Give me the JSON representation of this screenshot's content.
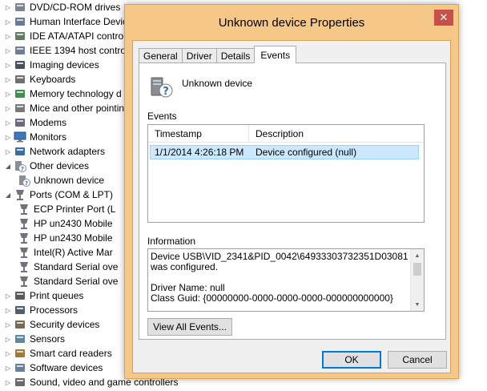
{
  "tree": {
    "items": [
      {
        "label": "DVD/CD-ROM drives",
        "icon": "dvd-drive-icon",
        "level": 0,
        "expander": "collapsed"
      },
      {
        "label": "Human Interface Devic",
        "icon": "hid-icon",
        "level": 0,
        "expander": "collapsed"
      },
      {
        "label": "IDE ATA/ATAPI control",
        "icon": "ide-controller-icon",
        "level": 0,
        "expander": "collapsed"
      },
      {
        "label": "IEEE 1394 host controll",
        "icon": "ieee1394-icon",
        "level": 0,
        "expander": "collapsed"
      },
      {
        "label": "Imaging devices",
        "icon": "camera-icon",
        "level": 0,
        "expander": "collapsed"
      },
      {
        "label": "Keyboards",
        "icon": "keyboard-icon",
        "level": 0,
        "expander": "collapsed"
      },
      {
        "label": "Memory technology d",
        "icon": "memory-icon",
        "level": 0,
        "expander": "collapsed"
      },
      {
        "label": "Mice and other pointin",
        "icon": "mouse-icon",
        "level": 0,
        "expander": "collapsed"
      },
      {
        "label": "Modems",
        "icon": "modem-icon",
        "level": 0,
        "expander": "collapsed"
      },
      {
        "label": "Monitors",
        "icon": "monitor-icon",
        "level": 0,
        "expander": "collapsed"
      },
      {
        "label": "Network adapters",
        "icon": "network-adapter-icon",
        "level": 0,
        "expander": "collapsed"
      },
      {
        "label": "Other devices",
        "icon": "other-devices-icon",
        "level": 0,
        "expander": "expanded"
      },
      {
        "label": "Unknown device",
        "icon": "unknown-device-icon",
        "level": 1,
        "expander": "none"
      },
      {
        "label": "Ports (COM & LPT)",
        "icon": "port-icon",
        "level": 0,
        "expander": "expanded"
      },
      {
        "label": "ECP Printer Port (L",
        "icon": "port-icon",
        "level": 1,
        "expander": "none"
      },
      {
        "label": "HP un2430 Mobile",
        "icon": "port-icon",
        "level": 1,
        "expander": "none"
      },
      {
        "label": "HP un2430 Mobile",
        "icon": "port-icon",
        "level": 1,
        "expander": "none"
      },
      {
        "label": "Intel(R) Active Mar",
        "icon": "port-icon",
        "level": 1,
        "expander": "none"
      },
      {
        "label": "Standard Serial ove",
        "icon": "port-icon",
        "level": 1,
        "expander": "none"
      },
      {
        "label": "Standard Serial ove",
        "icon": "port-icon",
        "level": 1,
        "expander": "none"
      },
      {
        "label": "Print queues",
        "icon": "printer-icon",
        "level": 0,
        "expander": "collapsed"
      },
      {
        "label": "Processors",
        "icon": "processor-icon",
        "level": 0,
        "expander": "collapsed"
      },
      {
        "label": "Security devices",
        "icon": "security-device-icon",
        "level": 0,
        "expander": "collapsed"
      },
      {
        "label": "Sensors",
        "icon": "sensor-icon",
        "level": 0,
        "expander": "collapsed"
      },
      {
        "label": "Smart card readers",
        "icon": "smart-card-icon",
        "level": 0,
        "expander": "collapsed"
      },
      {
        "label": "Software devices",
        "icon": "software-device-icon",
        "level": 0,
        "expander": "collapsed"
      },
      {
        "label": "Sound, video and game controllers",
        "icon": "sound-icon",
        "level": 0,
        "expander": "collapsed"
      }
    ]
  },
  "dialog": {
    "title": "Unknown device Properties",
    "close_glyph": "✕",
    "tabs": [
      {
        "label": "General",
        "active": false
      },
      {
        "label": "Driver",
        "active": false
      },
      {
        "label": "Details",
        "active": false
      },
      {
        "label": "Events",
        "active": true
      }
    ],
    "device_name": "Unknown device",
    "events_label": "Events",
    "events_columns": {
      "timestamp": "Timestamp",
      "description": "Description"
    },
    "events": [
      {
        "timestamp": "1/1/2014 4:26:18 PM",
        "description": "Device configured (null)",
        "selected": true
      }
    ],
    "information_label": "Information",
    "information_lines": [
      "Device USB\\VID_2341&PID_0042\\64933303732351D03081 was configured.",
      "",
      "Driver Name: null",
      "Class Guid: {00000000-0000-0000-0000-000000000000}"
    ],
    "view_all_button": "View All Events...",
    "ok_button": "OK",
    "cancel_button": "Cancel"
  },
  "colors": {
    "dialog_frame": "#f5c888",
    "close_button": "#c7504a",
    "selection": "#cce8ff",
    "selection_border": "#99d1ff",
    "default_button_border": "#0078d7"
  }
}
